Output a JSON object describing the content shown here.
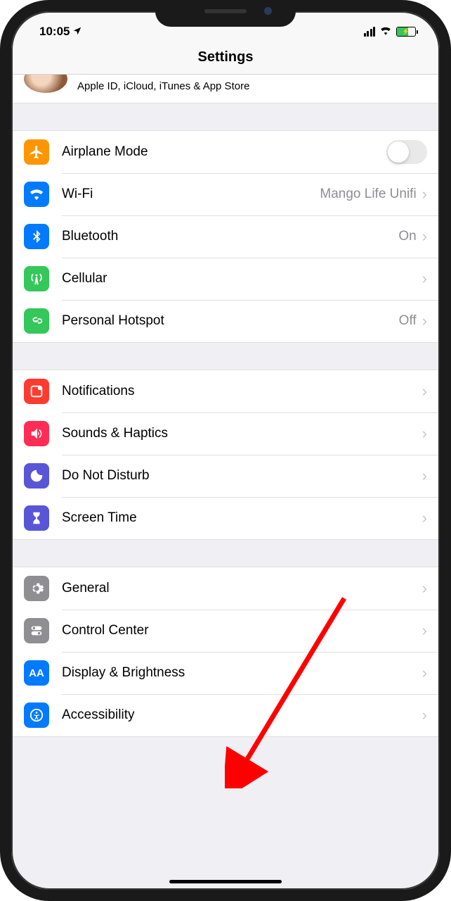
{
  "status": {
    "time": "10:05",
    "location_on": true
  },
  "header": {
    "title": "Settings"
  },
  "profile": {
    "subtitle": "Apple ID, iCloud, iTunes & App Store"
  },
  "groups": [
    {
      "rows": [
        {
          "id": "airplane-mode",
          "icon": "airplane",
          "color": "bg-orange",
          "label": "Airplane Mode",
          "type": "toggle",
          "value_on": false
        },
        {
          "id": "wifi",
          "icon": "wifi",
          "color": "bg-blue",
          "label": "Wi-Fi",
          "type": "link",
          "detail": "Mango Life Unifi"
        },
        {
          "id": "bluetooth",
          "icon": "bluetooth",
          "color": "bg-btblue",
          "label": "Bluetooth",
          "type": "link",
          "detail": "On"
        },
        {
          "id": "cellular",
          "icon": "antenna",
          "color": "bg-green",
          "label": "Cellular",
          "type": "link",
          "detail": ""
        },
        {
          "id": "personal-hotspot",
          "icon": "link",
          "color": "bg-green2",
          "label": "Personal Hotspot",
          "type": "link",
          "detail": "Off"
        }
      ]
    },
    {
      "rows": [
        {
          "id": "notifications",
          "icon": "bell-square",
          "color": "bg-red",
          "label": "Notifications",
          "type": "link",
          "detail": ""
        },
        {
          "id": "sounds-haptics",
          "icon": "speaker",
          "color": "bg-pink",
          "label": "Sounds & Haptics",
          "type": "link",
          "detail": ""
        },
        {
          "id": "do-not-disturb",
          "icon": "moon",
          "color": "bg-purple",
          "label": "Do Not Disturb",
          "type": "link",
          "detail": ""
        },
        {
          "id": "screen-time",
          "icon": "hourglass",
          "color": "bg-indigo",
          "label": "Screen Time",
          "type": "link",
          "detail": ""
        }
      ]
    },
    {
      "rows": [
        {
          "id": "general",
          "icon": "gear",
          "color": "bg-gray",
          "label": "General",
          "type": "link",
          "detail": ""
        },
        {
          "id": "control-center",
          "icon": "toggles",
          "color": "bg-gray2",
          "label": "Control Center",
          "type": "link",
          "detail": ""
        },
        {
          "id": "display-brightness",
          "icon": "aa",
          "color": "bg-blue2",
          "label": "Display & Brightness",
          "type": "link",
          "detail": ""
        },
        {
          "id": "accessibility",
          "icon": "person-circle",
          "color": "bg-blue3",
          "label": "Accessibility",
          "type": "link",
          "detail": ""
        }
      ]
    }
  ]
}
